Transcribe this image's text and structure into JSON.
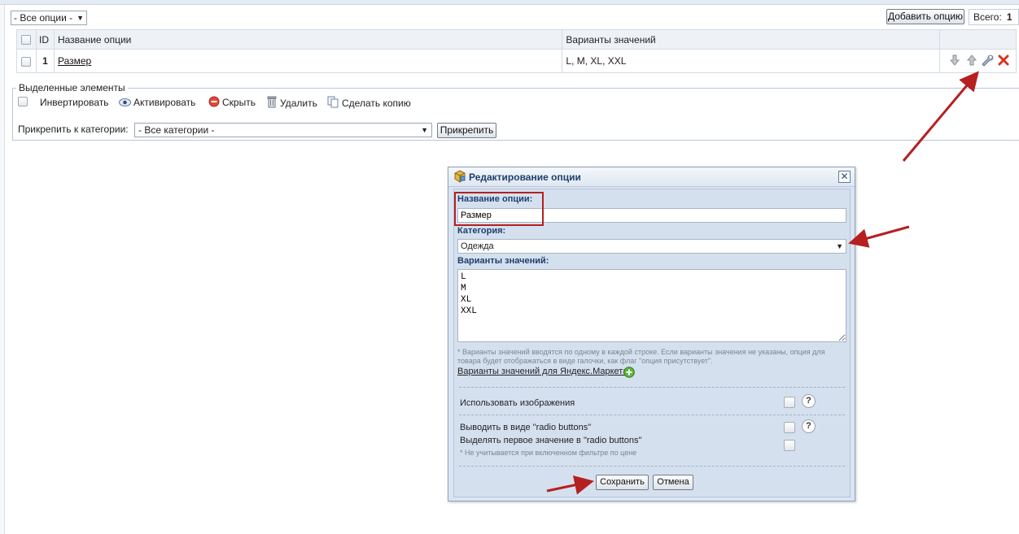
{
  "toolbar": {
    "filter_value": "- Все опции -",
    "add_button": "Добавить опцию",
    "total_label": "Всего:",
    "total_value": "1"
  },
  "table": {
    "headers": [
      "ID",
      "Название опции",
      "Варианты значений"
    ],
    "rows": [
      {
        "id": "1",
        "name": "Размер",
        "values": "L, M, XL, XXL"
      }
    ]
  },
  "selected": {
    "legend": "Выделенные элементы",
    "invert": "Инвертировать",
    "activate": "Активировать",
    "hide": "Скрыть",
    "delete": "Удалить",
    "copy": "Сделать копию",
    "attach_label": "Прикрепить к категории:",
    "attach_value": "- Все категории -",
    "attach_button": "Прикрепить"
  },
  "dialog": {
    "title": "Редактирование опции",
    "name_label": "Название опции:",
    "name_value": "Размер",
    "category_label": "Категория:",
    "category_value": "Одежда",
    "values_label": "Варианты значений:",
    "values_text": "L\nM\nXL\nXXL",
    "hint_1": "* Варианты значений вводятся по одному в каждой строке. Если варианты значения не указаны, опция для",
    "hint_2": "товара будет отображаться в виде галочки, как флаг \"опция присутствует\".",
    "yandex_link": "Варианты значений для Яндекс.Маркета",
    "use_images": "Использовать изображения",
    "radio_buttons": "Выводить в виде \"radio buttons\"",
    "radio_first": "Выделять первое значение в \"radio buttons\"",
    "radio_note": "* Не учитывается при включенном фильтре по цене",
    "help_glyph": "?",
    "save": "Сохранить",
    "cancel": "Отмена"
  },
  "colors": {
    "annotation_red": "#b52020",
    "dialog_bg": "#d5e0ef",
    "label_blue": "#1f3f6a"
  }
}
